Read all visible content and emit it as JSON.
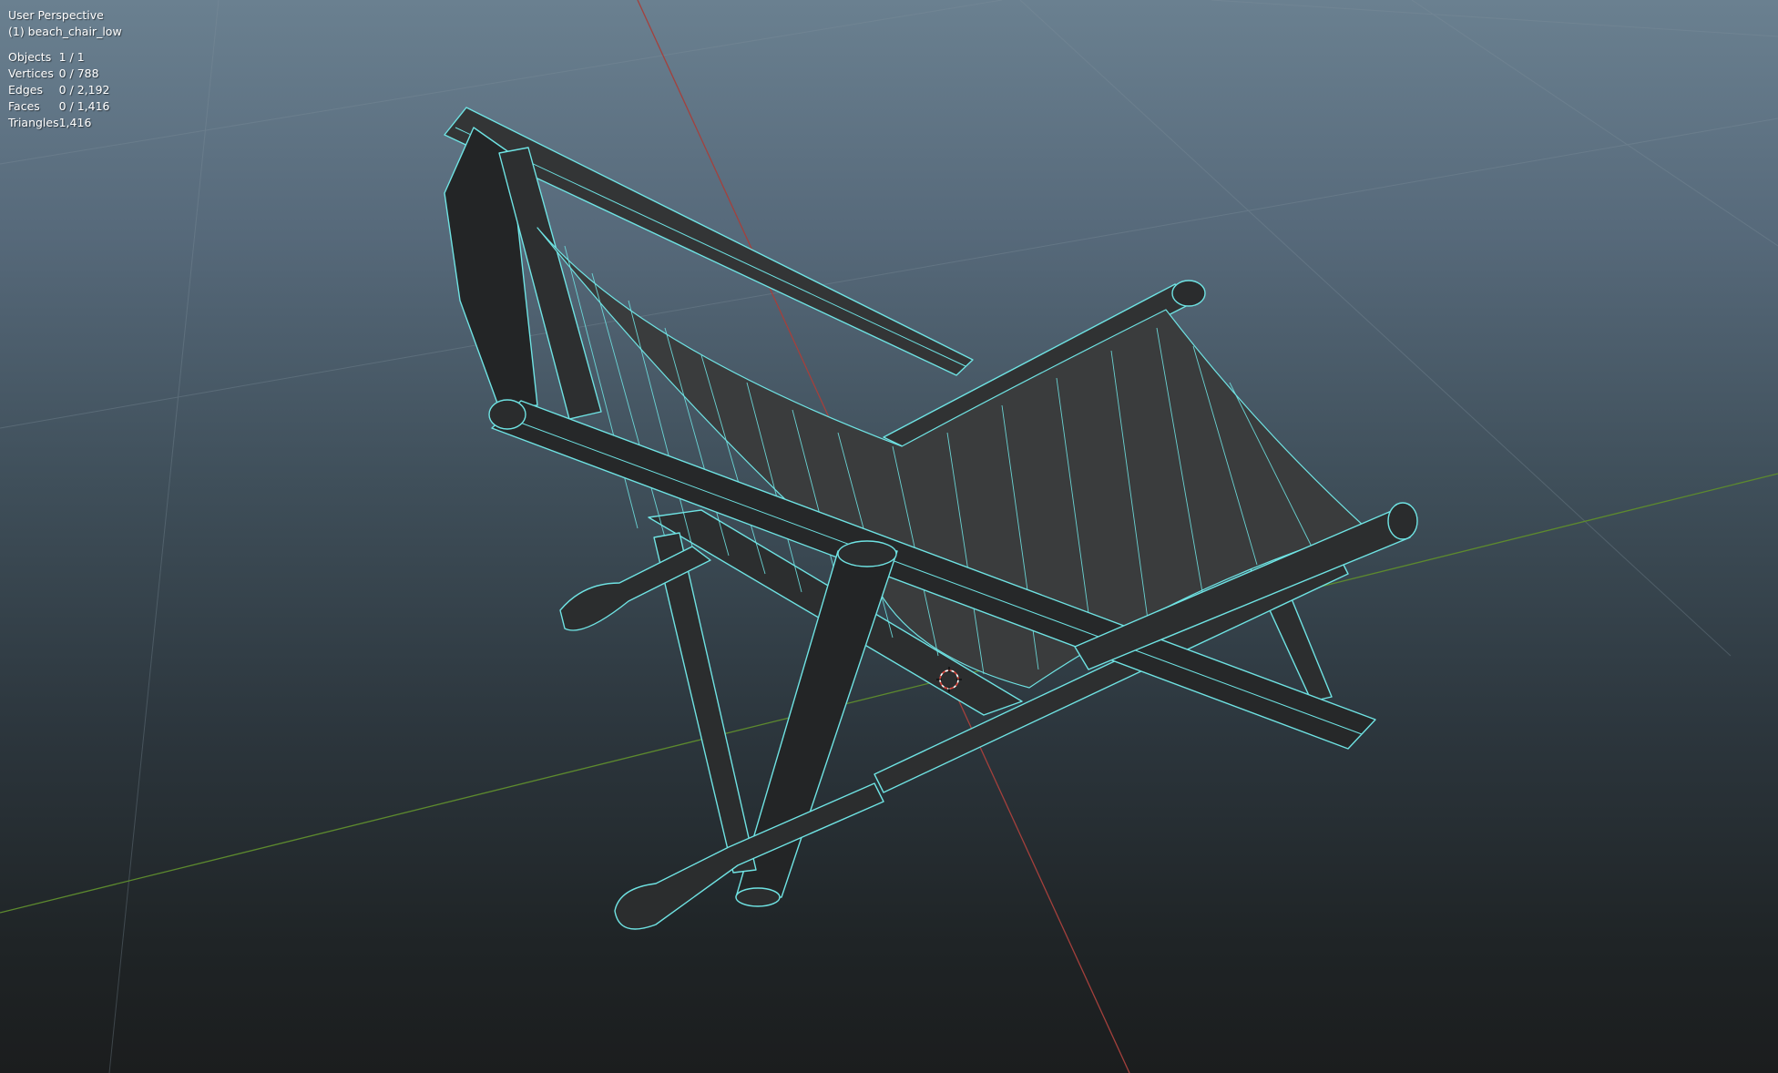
{
  "viewport": {
    "view_name": "User Perspective",
    "object_name": "(1) beach_chair_low",
    "stats": [
      {
        "key": "objects",
        "label": "Objects",
        "value": "1 / 1"
      },
      {
        "key": "vertices",
        "label": "Vertices",
        "value": "0 / 788"
      },
      {
        "key": "edges",
        "label": "Edges",
        "value": "0 / 2,192"
      },
      {
        "key": "faces",
        "label": "Faces",
        "value": "0 / 1,416"
      },
      {
        "key": "triangles",
        "label": "Triangles",
        "value": "1,416"
      }
    ]
  },
  "colors": {
    "wire": "#6fe3e3",
    "mesh_fill": "#2a2c2d",
    "x_axis": "#a4403c",
    "y_axis": "#5d8a2e",
    "grid": "#7f909c"
  },
  "icons": {
    "cursor": "3d-cursor-icon"
  }
}
